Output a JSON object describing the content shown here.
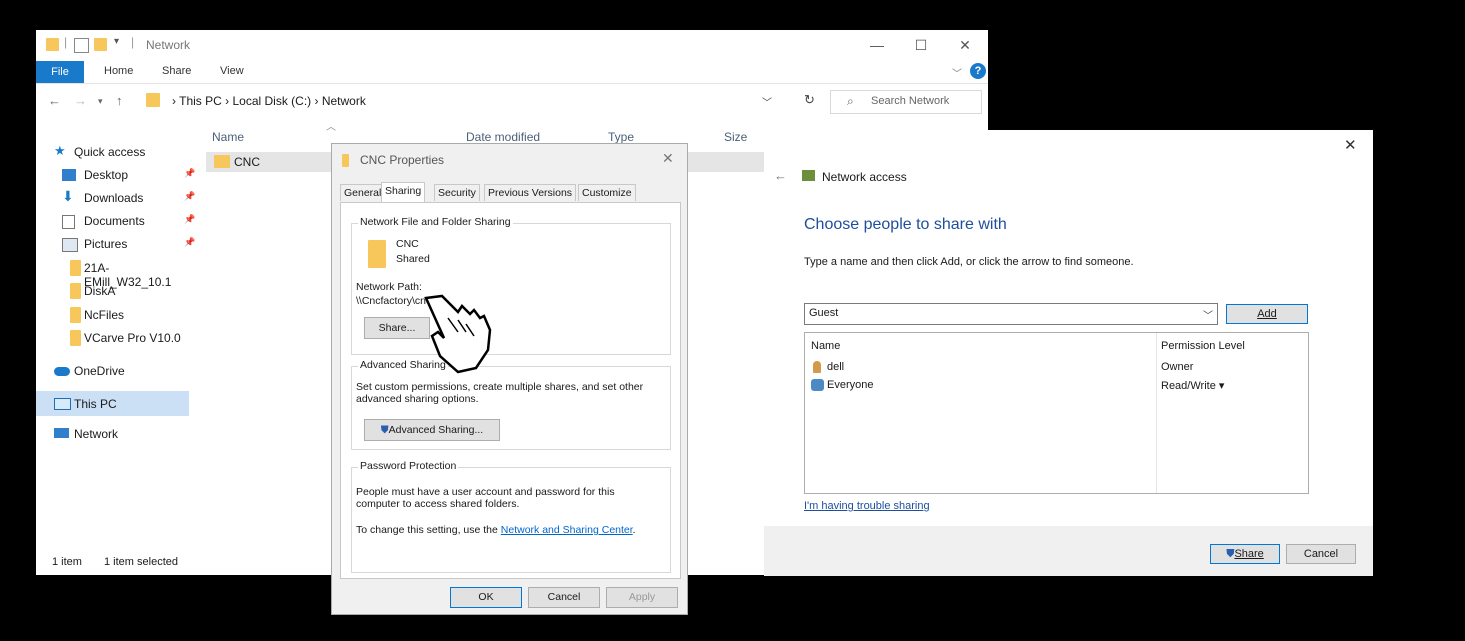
{
  "explorer": {
    "title": "Network",
    "ribbon_tabs": [
      "File",
      "Home",
      "Share",
      "View"
    ],
    "breadcrumb": [
      "This PC",
      "Local Disk (C:)",
      "Network"
    ],
    "search_placeholder": "Search Network",
    "sidebar": [
      {
        "label": "Quick access",
        "icon": "star-icon",
        "pinned": false
      },
      {
        "label": "Desktop",
        "icon": "desktop-icon",
        "pinned": true
      },
      {
        "label": "Downloads",
        "icon": "download-icon",
        "pinned": true
      },
      {
        "label": "Documents",
        "icon": "documents-icon",
        "pinned": true
      },
      {
        "label": "Pictures",
        "icon": "pictures-icon",
        "pinned": true
      },
      {
        "label": "21A-EMill_W32_10.1",
        "icon": "folder-icon",
        "pinned": false
      },
      {
        "label": "DiskA",
        "icon": "folder-icon",
        "pinned": false
      },
      {
        "label": "NcFiles",
        "icon": "folder-icon",
        "pinned": false
      },
      {
        "label": "VCarve Pro V10.0",
        "icon": "folder-icon",
        "pinned": false
      },
      {
        "label": "OneDrive",
        "icon": "cloud-icon",
        "pinned": false
      },
      {
        "label": "This PC",
        "icon": "computer-icon",
        "pinned": false
      },
      {
        "label": "Network",
        "icon": "network-icon",
        "pinned": false
      }
    ],
    "columns": [
      "Name",
      "Date modified",
      "Type",
      "Size"
    ],
    "files": [
      {
        "name": "CNC"
      }
    ],
    "status": {
      "count": "1 item",
      "selected": "1 item selected"
    }
  },
  "props": {
    "title": "CNC Properties",
    "tabs": [
      "General",
      "Sharing",
      "Security",
      "Previous Versions",
      "Customize"
    ],
    "nffs_label": "Network File and Folder Sharing",
    "folder_name": "CNC",
    "folder_state": "Shared",
    "network_path_label": "Network Path:",
    "network_path": "\\\\Cncfactory\\cnc",
    "share_btn": "Share...",
    "adv_label": "Advanced Sharing",
    "adv_desc": "Set custom permissions, create multiple shares, and set other advanced sharing options.",
    "adv_btn": "Advanced Sharing...",
    "pwd_label": "Password Protection",
    "pwd_desc": "People must have a user account and password for this computer to access shared folders.",
    "pwd_change": "To change this setting, use the ",
    "pwd_link": "Network and Sharing Center",
    "pwd_end": ".",
    "ok": "OK",
    "cancel": "Cancel",
    "apply": "Apply"
  },
  "netacc": {
    "title": "Network access",
    "heading": "Choose people to share with",
    "instruction": "Type a name and then click Add, or click the arrow to find someone.",
    "input_value": "Guest",
    "add_btn": "Add",
    "col_name": "Name",
    "col_perm": "Permission Level",
    "users": [
      {
        "name": "dell",
        "perm": "Owner"
      },
      {
        "name": "Everyone",
        "perm": "Read/Write ▾"
      }
    ],
    "trouble_link": "I'm having trouble sharing",
    "share_btn": "Share",
    "cancel_btn": "Cancel"
  }
}
